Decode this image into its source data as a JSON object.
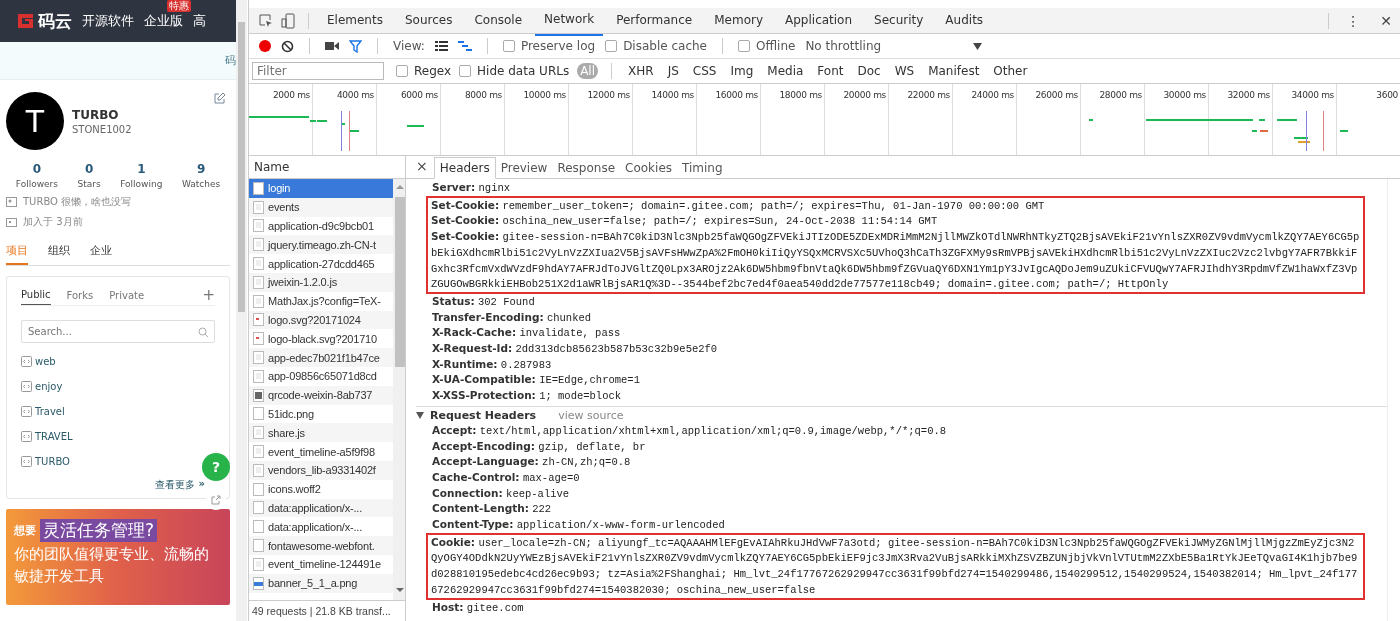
{
  "site": {
    "logo": "码云",
    "nav": [
      {
        "label": "开源软件"
      },
      {
        "label": "企业版",
        "badge": "特惠"
      },
      {
        "label": "高"
      }
    ],
    "notice": "码",
    "profile": {
      "avatar": "T",
      "name": "TURBO",
      "username": "STONE1002",
      "stats": [
        {
          "value": "0",
          "label": "Followers"
        },
        {
          "value": "0",
          "label": "Stars"
        },
        {
          "value": "1",
          "label": "Following"
        },
        {
          "value": "9",
          "label": "Watches"
        }
      ],
      "bio": "TURBO 很懒，啥也没写",
      "joined": "加入于 3月前"
    },
    "tabs": [
      {
        "label": "项目",
        "selected": true
      },
      {
        "label": "组织",
        "selected": false
      },
      {
        "label": "企业",
        "selected": false
      }
    ],
    "repo_tabs": [
      {
        "label": "Public",
        "selected": true
      },
      {
        "label": "Forks",
        "selected": false
      },
      {
        "label": "Private",
        "selected": false
      }
    ],
    "add": "+",
    "search": {
      "placeholder": "Search..."
    },
    "repos": [
      "web",
      "enjoy",
      "Travel",
      "TRAVEL",
      "TURBO"
    ],
    "more": "查看更多",
    "more_arrow": "»",
    "help": "?",
    "ad": {
      "prefix": "想要",
      "headline": "灵活任务管理?",
      "lines": [
        "你的团队值得更专业、流畅的",
        "敏捷开发工具"
      ]
    }
  },
  "devtools": {
    "panels": [
      {
        "label": "Elements",
        "selected": false
      },
      {
        "label": "Sources",
        "selected": false
      },
      {
        "label": "Console",
        "selected": false
      },
      {
        "label": "Network",
        "selected": true
      },
      {
        "label": "Performance",
        "selected": false
      },
      {
        "label": "Memory",
        "selected": false
      },
      {
        "label": "Application",
        "selected": false
      },
      {
        "label": "Security",
        "selected": false
      },
      {
        "label": "Audits",
        "selected": false
      }
    ],
    "menu": "⋮",
    "close": "✕",
    "toolbar": {
      "recording": true,
      "view_label": "View:",
      "options": [
        {
          "label": "Preserve log",
          "checked": false
        },
        {
          "label": "Disable cache",
          "checked": false
        }
      ],
      "offline": {
        "label": "Offline",
        "checked": false
      },
      "throttling": "No throttling"
    },
    "filter": {
      "placeholder": "Filter",
      "options": [
        {
          "label": "Regex",
          "checked": false
        },
        {
          "label": "Hide data URLs",
          "checked": false
        }
      ],
      "types": [
        {
          "label": "All",
          "selected": true
        },
        {
          "label": "XHR",
          "selected": false
        },
        {
          "label": "JS",
          "selected": false
        },
        {
          "label": "CSS",
          "selected": false
        },
        {
          "label": "Img",
          "selected": false
        },
        {
          "label": "Media",
          "selected": false
        },
        {
          "label": "Font",
          "selected": false
        },
        {
          "label": "Doc",
          "selected": false
        },
        {
          "label": "WS",
          "selected": false
        },
        {
          "label": "Manifest",
          "selected": false
        },
        {
          "label": "Other",
          "selected": false
        }
      ]
    },
    "timeline": {
      "ticks": [
        "2000 ms",
        "4000 ms",
        "6000 ms",
        "8000 ms",
        "10000 ms",
        "12000 ms",
        "14000 ms",
        "16000 ms",
        "18000 ms",
        "20000 ms",
        "22000 ms",
        "24000 ms",
        "26000 ms",
        "28000 ms",
        "30000 ms",
        "32000 ms",
        "34000 ms",
        "3600"
      ]
    },
    "name_header": "Name",
    "requests": [
      {
        "name": "login",
        "kind": "doc",
        "selected": true
      },
      {
        "name": "events",
        "kind": "file",
        "selected": false
      },
      {
        "name": "application-d9c9bcb01",
        "kind": "file",
        "selected": false
      },
      {
        "name": "jquery.timeago.zh-CN-t",
        "kind": "file",
        "selected": false
      },
      {
        "name": "application-27dcdd465",
        "kind": "file",
        "selected": false
      },
      {
        "name": "jweixin-1.2.0.js",
        "kind": "file",
        "selected": false
      },
      {
        "name": "MathJax.js?config=TeX-",
        "kind": "file",
        "selected": false
      },
      {
        "name": "logo.svg?20171024",
        "kind": "svg",
        "selected": false
      },
      {
        "name": "logo-black.svg?201710",
        "kind": "svg",
        "selected": false
      },
      {
        "name": "app-edec7b021f1b47ce",
        "kind": "file",
        "selected": false
      },
      {
        "name": "app-09856c65071d8cd",
        "kind": "file",
        "selected": false
      },
      {
        "name": "qrcode-weixin-8ab737",
        "kind": "image",
        "selected": false
      },
      {
        "name": "51idc.png",
        "kind": "doc",
        "selected": false
      },
      {
        "name": "share.js",
        "kind": "file",
        "selected": false
      },
      {
        "name": "event_timeline-a5f9f98",
        "kind": "file",
        "selected": false
      },
      {
        "name": "vendors_lib-a9331402f",
        "kind": "file",
        "selected": false
      },
      {
        "name": "icons.woff2",
        "kind": "doc",
        "selected": false
      },
      {
        "name": "data:application/x-...",
        "kind": "doc",
        "selected": false
      },
      {
        "name": "data:application/x-...",
        "kind": "doc",
        "selected": false
      },
      {
        "name": "fontawesome-webfont.",
        "kind": "doc",
        "selected": false
      },
      {
        "name": "event_timeline-124491e",
        "kind": "file",
        "selected": false
      },
      {
        "name": "banner_5_1_a.png",
        "kind": "banner",
        "selected": false
      }
    ],
    "summary": "49 requests  |  21.8 KB transf...",
    "detail_close": "×",
    "detail_tabs": [
      {
        "label": "Headers",
        "selected": true
      },
      {
        "label": "Preview",
        "selected": false
      },
      {
        "label": "Response",
        "selected": false
      },
      {
        "label": "Cookies",
        "selected": false
      },
      {
        "label": "Timing",
        "selected": false
      }
    ],
    "response_headers": [
      {
        "highlighted": false,
        "headers": [
          {
            "name": "Server:",
            "value": "nginx"
          }
        ]
      },
      {
        "highlighted": true,
        "headers": [
          {
            "name": "Set-Cookie:",
            "value": "remember_user_token=; domain=.gitee.com; path=/; expires=Thu, 01-Jan-1970 00:00:00 GMT"
          },
          {
            "name": "Set-Cookie:",
            "value": "oschina_new_user=false; path=/; expires=Sun, 24-Oct-2038 11:54:14 GMT"
          },
          {
            "name": "Set-Cookie:",
            "value": "gitee-session-n=BAh7C0kiD3Nlc3Npb25faWQGOgZFVEkiJTIzODE5ZDExMDRiMmM2NjllMWZkOTdlNWRhNTkyZTQ2BjsAVEkiF21vYnlsZXR0ZV9vdmVycmlkZQY7AEY6CG5pbEkiGXdhcmRlbi51c2VyLnVzZXIua2V5BjsAVFsHWwZpA%2FmOH0kiIiQyYSQxMCRVSXc5UVhoQ3hCaTh3ZGFXMy9sRmVPBjsAVEkiHXdhcmRlbi51c2VyLnVzZXIuc2Vzc2lvbgY7AFR7BkkiFGxhc3RfcmVxdWVzdF9hdAY7AFRJdToJVGltZQ0Lpx3AROjz2Ak6DW5hbm9fbnVtaQk6DW5hbm9fZGVuaQY6DXN1Ym1pY3JvIgcAQDoJem9uZUkiCFVUQwY7AFRJIhdhY3RpdmVfZW1haWxfZ3VpZGUGOwBGRkkiEHBob251X2d1aWRlBjsAR1Q%3D--3544bef2bc7ed4f0aea540dd2de77577e118cb49; domain=.gitee.com; path=/; HttpOnly"
          }
        ]
      },
      {
        "highlighted": false,
        "headers": [
          {
            "name": "Status:",
            "value": "302 Found"
          },
          {
            "name": "Transfer-Encoding:",
            "value": "chunked"
          },
          {
            "name": "X-Rack-Cache:",
            "value": "invalidate, pass"
          },
          {
            "name": "X-Request-Id:",
            "value": "2dd313dcb85623b587b53c32b9e5e2f0"
          },
          {
            "name": "X-Runtime:",
            "value": "0.287983"
          },
          {
            "name": "X-UA-Compatible:",
            "value": "IE=Edge,chrome=1"
          },
          {
            "name": "X-XSS-Protection:",
            "value": "1; mode=block"
          }
        ]
      }
    ],
    "request_section": {
      "title": "Request Headers",
      "expanded": true,
      "link": "view source"
    },
    "request_headers": [
      {
        "highlighted": false,
        "headers": [
          {
            "name": "Accept:",
            "value": "text/html,application/xhtml+xml,application/xml;q=0.9,image/webp,*/*;q=0.8"
          },
          {
            "name": "Accept-Encoding:",
            "value": "gzip, deflate, br"
          },
          {
            "name": "Accept-Language:",
            "value": "zh-CN,zh;q=0.8"
          },
          {
            "name": "Cache-Control:",
            "value": "max-age=0"
          },
          {
            "name": "Connection:",
            "value": "keep-alive"
          },
          {
            "name": "Content-Length:",
            "value": "222"
          },
          {
            "name": "Content-Type:",
            "value": "application/x-www-form-urlencoded"
          }
        ]
      },
      {
        "highlighted": true,
        "headers": [
          {
            "name": "Cookie:",
            "value": "user_locale=zh-CN; aliyungf_tc=AQAAAHMlEFgEvAIAhRkuJHdVwF7a3otd; gitee-session-n=BAh7C0kiD3Nlc3Npb25faWQGOgZFVEkiJWMyZGNlMjllMjgzZmEyZjc3N2QyOGY4ODdkN2UyYWEzBjsAVEkiF21vYnlsZXR0ZV9vdmVycmlkZQY7AEY6CG5pbEkiEF9jc3JmX3Rva2VuBjsARkkiMXhZSVZBZUNjbjVkVnlVTUtmM2ZXbE5Ba1RtYkJEeTQvaGI4K1hjb7be9d028810195edebc4cd26ec9b93; tz=Asia%2FShanghai; Hm_lvt_24f17767262929947cc3631f99bfd274=1540299486,1540299512,1540299524,1540382014; Hm_lpvt_24f17767262929947cc3631f99bfd274=1540382030; oschina_new_user=false"
          }
        ]
      },
      {
        "highlighted": false,
        "headers": [
          {
            "name": "Host:",
            "value": "gitee.com"
          }
        ]
      }
    ]
  }
}
